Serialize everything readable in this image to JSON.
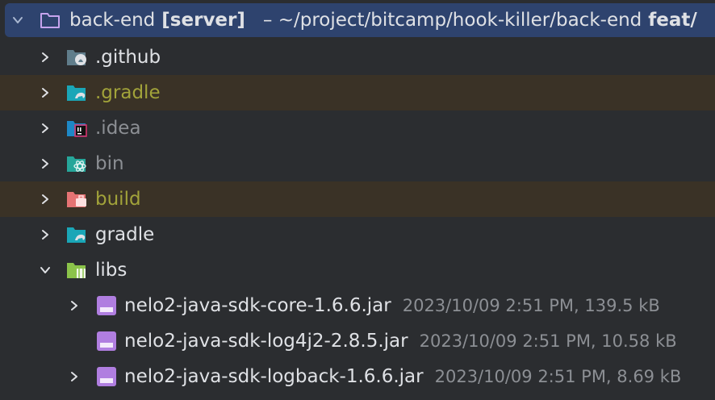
{
  "root": {
    "name": "back-end",
    "module": "[server]",
    "path": "– ~/project/bitcamp/hook-killer/back-end",
    "branch": "feat/"
  },
  "items": [
    {
      "name": ".github",
      "icon": "github-folder-icon"
    },
    {
      "name": ".gradle",
      "icon": "gradle-folder-icon"
    },
    {
      "name": ".idea",
      "icon": "idea-folder-icon"
    },
    {
      "name": "bin",
      "icon": "react-folder-icon"
    },
    {
      "name": "build",
      "icon": "build-folder-icon"
    },
    {
      "name": "gradle",
      "icon": "gradle-folder-icon"
    },
    {
      "name": "libs",
      "icon": "lib-folder-icon"
    }
  ],
  "files": [
    {
      "name": "nelo2-java-sdk-core-1.6.6.jar",
      "meta": "2023/10/09 2:51 PM, 139.5 kB"
    },
    {
      "name": "nelo2-java-sdk-log4j2-2.8.5.jar",
      "meta": "2023/10/09 2:51 PM, 10.58 kB"
    },
    {
      "name": "nelo2-java-sdk-logback-1.6.6.jar",
      "meta": "2023/10/09 2:51 PM, 8.69 kB"
    }
  ],
  "colors": {
    "background": "#2b2d30",
    "selection": "#2e436e",
    "excluded_row": "#3a3226",
    "excluded_text": "#a2a33a",
    "dim_text": "#8c8f94",
    "jar_icon": "#b07ee0"
  }
}
